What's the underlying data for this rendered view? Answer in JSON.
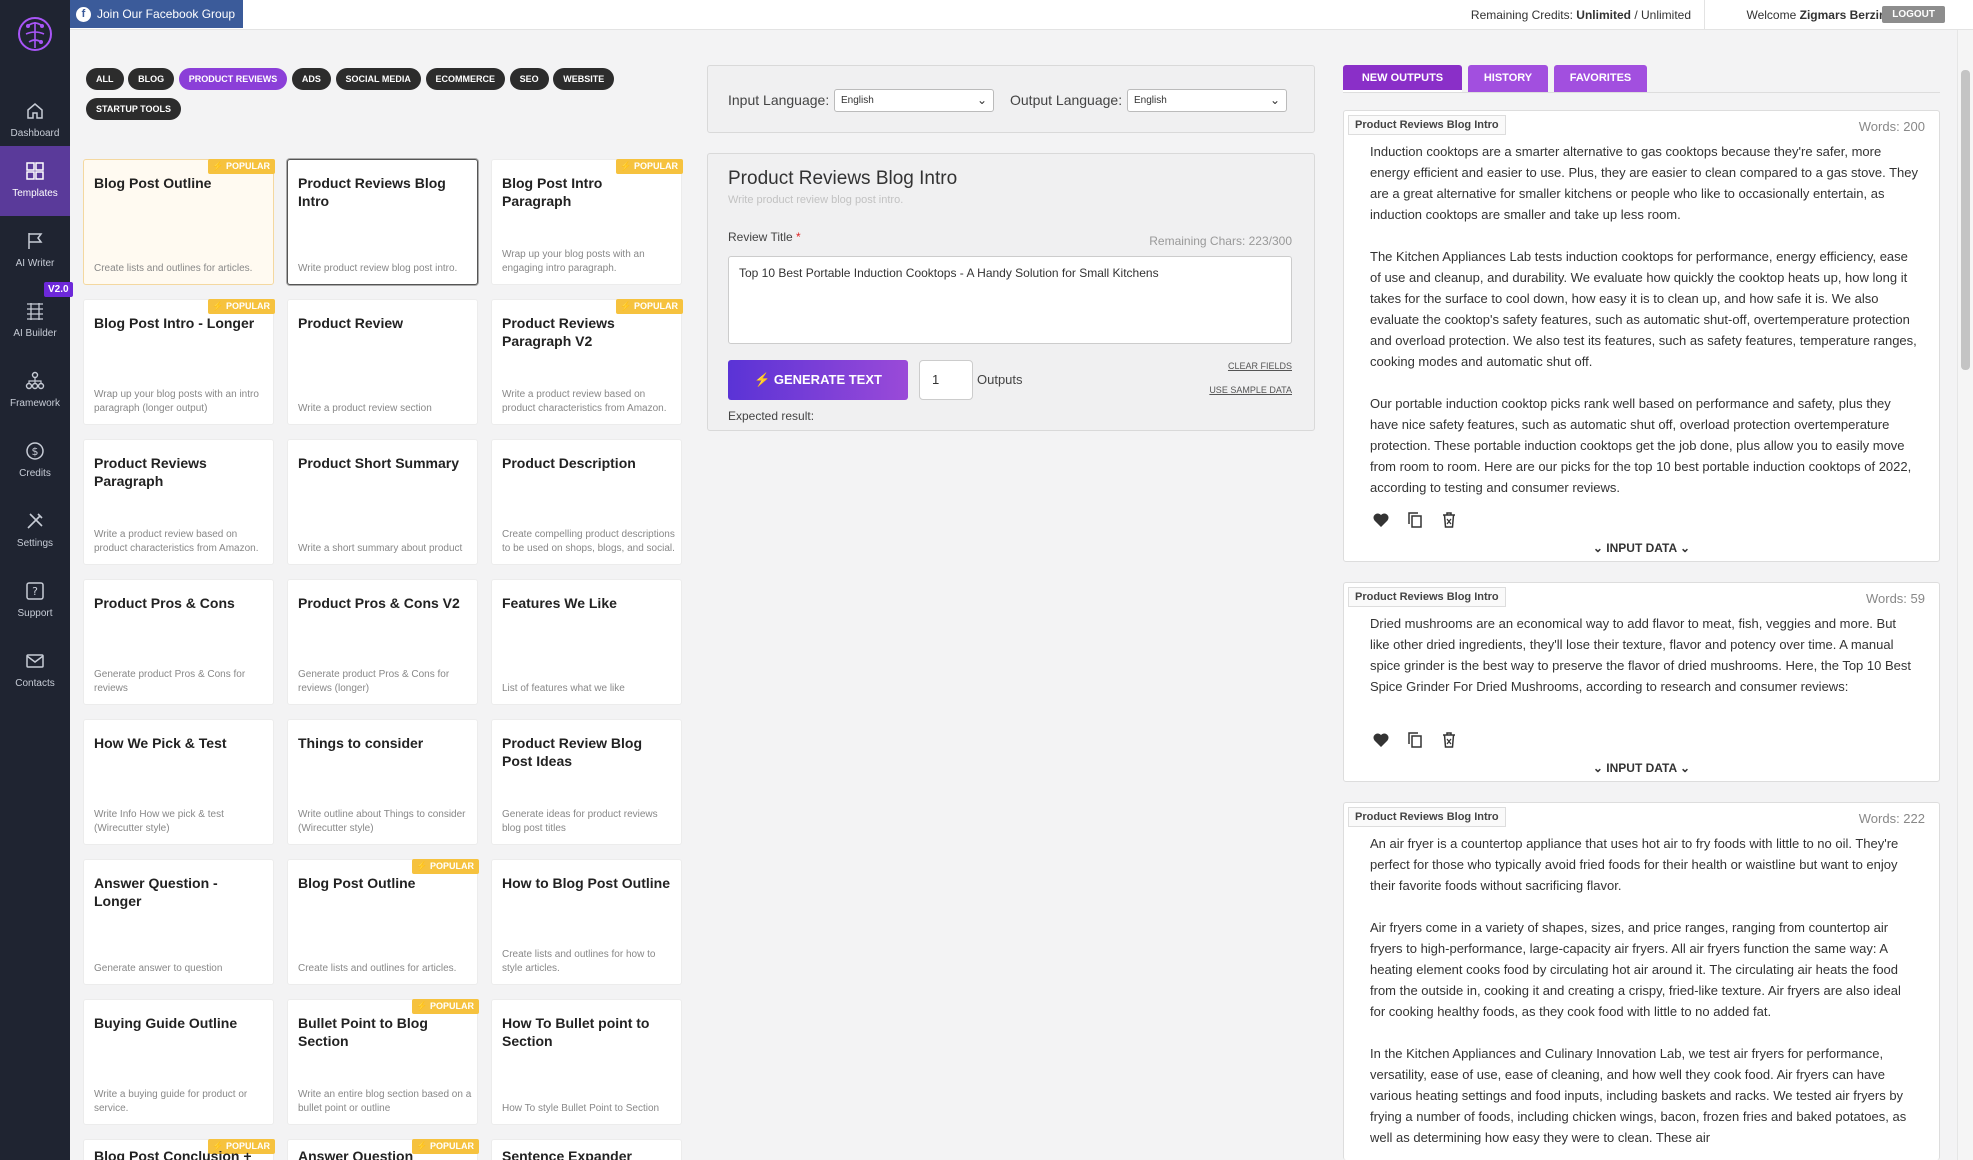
{
  "sidebar": {
    "items": [
      {
        "label": "Dashboard"
      },
      {
        "label": "Templates"
      },
      {
        "label": "AI Writer"
      },
      {
        "label": "AI Builder"
      },
      {
        "label": "Framework"
      },
      {
        "label": "Credits"
      },
      {
        "label": "Settings"
      },
      {
        "label": "Support"
      },
      {
        "label": "Contacts"
      }
    ],
    "v2_badge": "V2.0"
  },
  "topbar": {
    "facebook_label": "Join Our Facebook Group",
    "credits_prefix": "Remaining Credits:",
    "credits_value": "Unlimited",
    "credits_suffix": "/ Unlimited",
    "welcome_prefix": "Welcome",
    "user_name": "Zigmars Berzins",
    "logout_label": "LOGOUT"
  },
  "categories": [
    "ALL",
    "BLOG",
    "PRODUCT REVIEWS",
    "ADS",
    "SOCIAL MEDIA",
    "ECOMMERCE",
    "SEO",
    "WEBSITE",
    "STARTUP TOOLS"
  ],
  "popular_label": "⚡ POPULAR",
  "templates": [
    {
      "title": "Blog Post Outline",
      "desc": "Create lists and outlines for articles."
    },
    {
      "title": "Product Reviews Blog Intro",
      "desc": "Write product review blog post intro."
    },
    {
      "title": "Blog Post Intro Paragraph",
      "desc": "Wrap up your blog posts with an engaging intro paragraph."
    },
    {
      "title": "Blog Post Intro - Longer",
      "desc": "Wrap up your blog posts with an intro paragraph (longer output)"
    },
    {
      "title": "Product Review",
      "desc": "Write a product review section"
    },
    {
      "title": "Product Reviews Paragraph V2",
      "desc": "Write a product review based on product characteristics from Amazon."
    },
    {
      "title": "Product Reviews Paragraph",
      "desc": "Write a product review based on product characteristics from Amazon."
    },
    {
      "title": "Product Short Summary",
      "desc": "Write a short summary about product"
    },
    {
      "title": "Product Description",
      "desc": "Create compelling product descriptions to be used on shops, blogs, and social."
    },
    {
      "title": "Product Pros & Cons",
      "desc": "Generate product Pros & Cons for reviews"
    },
    {
      "title": "Product Pros & Cons V2",
      "desc": "Generate product Pros & Cons for reviews (longer)"
    },
    {
      "title": "Features We Like",
      "desc": "List of features what we like"
    },
    {
      "title": "How We Pick & Test",
      "desc": "Write Info How we pick & test (Wirecutter style)"
    },
    {
      "title": "Things to consider",
      "desc": "Write outline about Things to consider (Wirecutter style)"
    },
    {
      "title": "Product Review Blog Post Ideas",
      "desc": "Generate ideas for product reviews blog post titles"
    },
    {
      "title": "Answer Question - Longer",
      "desc": "Generate answer to question"
    },
    {
      "title": "Blog Post Outline",
      "desc": "Create lists and outlines for articles."
    },
    {
      "title": "How to Blog Post Outline",
      "desc": "Create lists and outlines for how to style articles."
    },
    {
      "title": "Buying Guide Outline",
      "desc": "Write a buying guide for product or service."
    },
    {
      "title": "Bullet Point to Blog Section",
      "desc": "Write an entire blog section based on a bullet point or outline"
    },
    {
      "title": "How To Bullet point to Section",
      "desc": "How To style Bullet Point to Section"
    },
    {
      "title": "Blog Post Conclusion +",
      "desc": ""
    },
    {
      "title": "Answer Question",
      "desc": ""
    },
    {
      "title": "Sentence Expander",
      "desc": ""
    }
  ],
  "language": {
    "input_label": "Input Language:",
    "input_value": "English",
    "output_label": "Output Language:",
    "output_value": "English"
  },
  "form": {
    "title": "Product Reviews Blog Intro",
    "subtitle": "Write product review blog post intro.",
    "field_label": "Review Title",
    "required_mark": "*",
    "remaining": "Remaining Chars: 223/300",
    "review_title_value": "Top 10 Best Portable Induction Cooktops - A Handy Solution for Small Kitchens",
    "generate_label": "GENERATE TEXT",
    "outputs_value": "1",
    "outputs_label": "Outputs",
    "clear_fields": "CLEAR FIELDS",
    "use_sample": "USE SAMPLE DATA",
    "expected": "Expected result:"
  },
  "tabs": [
    "NEW OUTPUTS",
    "HISTORY",
    "FAVORITES"
  ],
  "input_data_label": "INPUT DATA",
  "results": [
    {
      "tag": "Product Reviews Blog Intro",
      "words": "Words: 200",
      "paragraphs": [
        "Induction cooktops are a smarter alternative to gas cooktops because they're safer, more energy efficient and easier to use. Plus, they are easier to clean compared to a gas stove. They are a great alternative for smaller kitchens or people who like to occasionally entertain, as induction cooktops are smaller and take up less room.",
        "The Kitchen Appliances Lab tests induction cooktops for performance, energy efficiency, ease of use and cleanup, and durability. We evaluate how quickly the cooktop heats up, how long it takes for the surface to cool down, how easy it is to clean up, and how safe it is. We also evaluate the cooktop's safety features, such as automatic shut-off, overtemperature protection and overload protection. We also test its features, such as safety features, temperature ranges, cooking modes and automatic shut off.",
        "Our portable induction cooktop picks rank well based on performance and safety, plus they have nice safety features, such as automatic shut off, overload protection overtemperature protection. These portable induction cooktops get the job done, plus allow you to easily move from room to room. Here are our picks for the top 10 best portable induction cooktops of 2022, according to testing and consumer reviews."
      ]
    },
    {
      "tag": "Product Reviews Blog Intro",
      "words": "Words: 59",
      "paragraphs": [
        "Dried mushrooms are an economical way to add flavor to meat, fish, veggies and more. But like other dried ingredients, they'll lose their texture, flavor and potency over time. A manual spice grinder is the best way to preserve the flavor of dried mushrooms. Here, the Top 10 Best Spice Grinder For Dried Mushrooms, according to research and consumer reviews:"
      ]
    },
    {
      "tag": "Product Reviews Blog Intro",
      "words": "Words: 222",
      "paragraphs": [
        "An air fryer is a countertop appliance that uses hot air to fry foods with little to no oil. They're perfect for those who typically avoid fried foods for their health or waistline but want to enjoy their favorite foods without sacrificing flavor.",
        "Air fryers come in a variety of shapes, sizes, and price ranges, ranging from countertop air fryers to high-performance, large-capacity air fryers. All air fryers function the same way: A heating element cooks food by circulating hot air around it. The circulating air heats the food from the outside in, cooking it and creating a crispy, fried-like texture. Air fryers are also ideal for cooking healthy foods, as they cook food with little to no added fat.",
        "In the Kitchen Appliances and Culinary Innovation Lab, we test air fryers for performance, versatility, ease of use, ease of cleaning, and how well they cook food. Air fryers can have various heating settings and food inputs, including baskets and racks. We tested air fryers by frying a number of foods, including chicken wings, bacon, frozen fries and baked potatoes, as well as determining how easy they were to clean. These air"
      ]
    }
  ]
}
